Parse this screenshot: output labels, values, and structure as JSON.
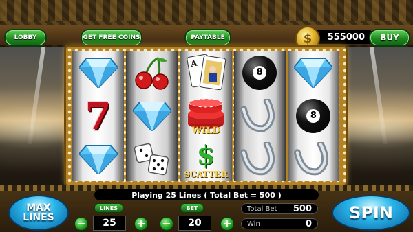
{
  "topbar": {
    "lobby_label": "LOBBY",
    "free_coins_label": "GET FREE COINS",
    "paytable_label": "PAYTABLE",
    "coin_balance": "555000",
    "coin_symbol": "$",
    "buy_label": "BUY"
  },
  "reels": [
    [
      "diamond",
      "seven",
      "diamond"
    ],
    [
      "cherries",
      "diamond",
      "dice"
    ],
    [
      "playing-cards",
      "wild-chips",
      "scatter-dollar"
    ],
    [
      "eight-ball",
      "horseshoe",
      "horseshoe"
    ],
    [
      "diamond",
      "eight-ball",
      "horseshoe"
    ]
  ],
  "symbols": {
    "seven_text": "7",
    "eight_text": "8",
    "wild_text": "WILD",
    "scatter_text": "SCATTER",
    "dollar_text": "$",
    "card_rank": "A"
  },
  "status": "Playing 25 Lines ( Total Bet = 500 )",
  "controls": {
    "max_lines_label": "MAX LINES",
    "lines_label": "LINES",
    "lines_value": "25",
    "bet_label": "BET",
    "bet_value": "20",
    "total_bet_label": "Total Bet",
    "total_bet_value": "500",
    "win_label": "Win",
    "win_value": "0",
    "spin_label": "SPIN",
    "minus": "−",
    "plus": "+"
  },
  "colors": {
    "button_green": "#1e8a1f",
    "spin_blue": "#29b5ea",
    "frame_gold": "#b58324"
  }
}
